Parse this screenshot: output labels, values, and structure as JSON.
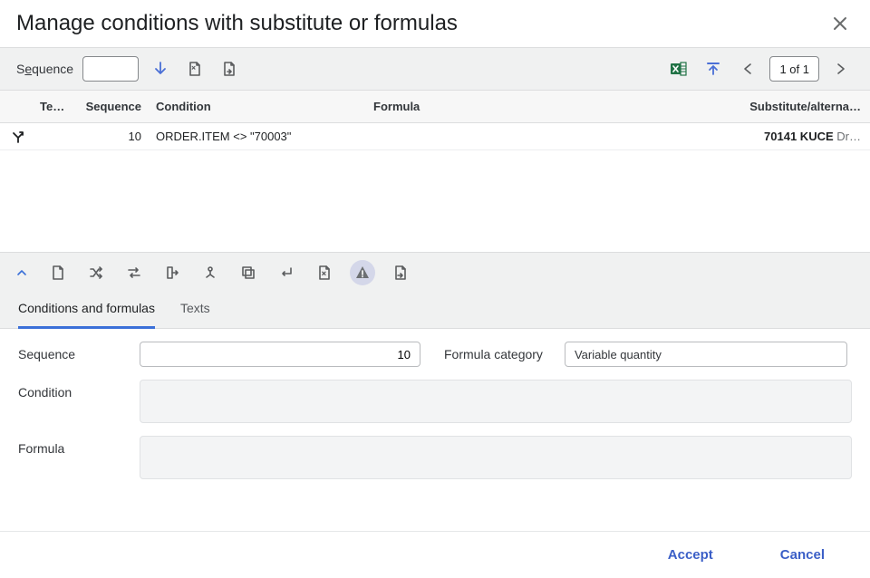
{
  "header": {
    "title": "Manage conditions with substitute or formulas"
  },
  "toolbar": {
    "sequence_label_pre": "S",
    "sequence_label_u": "e",
    "sequence_label_post": "quence",
    "sequence_value": "",
    "page_info": "1 of 1"
  },
  "grid": {
    "headers": {
      "text": "Text …",
      "sequence": "Sequence",
      "condition": "Condition",
      "formula": "Formula",
      "substitute": "Substitute/alterna…"
    },
    "row": {
      "sequence": "10",
      "condition": "ORDER.ITEM <> \"70003\"",
      "formula": "",
      "sub_bold": "70141 KUCE",
      "sub_rest": " Dr…"
    }
  },
  "tabs": {
    "cond": "Conditions and formulas",
    "texts": "Texts"
  },
  "form": {
    "sequence_label": "Sequence",
    "sequence_value": "10",
    "formula_cat_label": "Formula category",
    "formula_cat_value": "Variable quantity",
    "condition_label": "Condition",
    "formula_label": "Formula"
  },
  "footer": {
    "accept": "Accept",
    "cancel": "Cancel"
  }
}
